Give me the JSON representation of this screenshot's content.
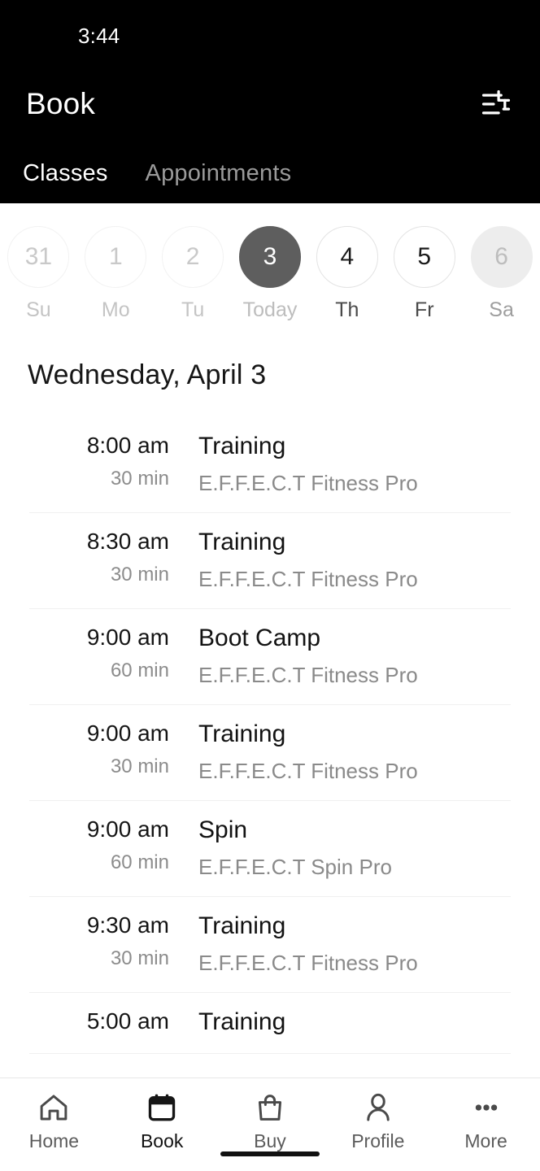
{
  "status_bar": {
    "time": "3:44"
  },
  "header": {
    "title": "Book",
    "filter_icon": "tune-sliders-icon",
    "tabs": [
      {
        "label": "Classes",
        "active": true
      },
      {
        "label": "Appointments",
        "active": false
      }
    ]
  },
  "date_strip": {
    "days": [
      {
        "number": "31",
        "weekday": "Su",
        "state": "past"
      },
      {
        "number": "1",
        "weekday": "Mo",
        "state": "past"
      },
      {
        "number": "2",
        "weekday": "Tu",
        "state": "past"
      },
      {
        "number": "3",
        "weekday": "Today",
        "state": "selected"
      },
      {
        "number": "4",
        "weekday": "Th",
        "state": "future"
      },
      {
        "number": "5",
        "weekday": "Fr",
        "state": "future"
      },
      {
        "number": "6",
        "weekday": "Sa",
        "state": "muted"
      }
    ]
  },
  "schedule": {
    "day_heading": "Wednesday, April 3",
    "rows": [
      {
        "time": "8:00 am",
        "duration": "30 min",
        "name": "Training",
        "location": "E.F.F.E.C.T Fitness Pro"
      },
      {
        "time": "8:30 am",
        "duration": "30 min",
        "name": "Training",
        "location": "E.F.F.E.C.T Fitness Pro"
      },
      {
        "time": "9:00 am",
        "duration": "60 min",
        "name": "Boot Camp",
        "location": "E.F.F.E.C.T Fitness Pro"
      },
      {
        "time": "9:00 am",
        "duration": "30 min",
        "name": "Training",
        "location": "E.F.F.E.C.T Fitness Pro"
      },
      {
        "time": "9:00 am",
        "duration": "60 min",
        "name": "Spin",
        "location": "E.F.F.E.C.T Spin Pro"
      },
      {
        "time": "9:30 am",
        "duration": "30 min",
        "name": "Training",
        "location": "E.F.F.E.C.T Fitness Pro"
      },
      {
        "time": "5:00 am",
        "duration": "",
        "name": "Training",
        "location": ""
      }
    ]
  },
  "bottom_nav": {
    "items": [
      {
        "label": "Home",
        "icon": "home-icon",
        "active": false
      },
      {
        "label": "Book",
        "icon": "calendar-icon",
        "active": true
      },
      {
        "label": "Buy",
        "icon": "bag-icon",
        "active": false
      },
      {
        "label": "Profile",
        "icon": "person-icon",
        "active": false
      },
      {
        "label": "More",
        "icon": "ellipsis-icon",
        "active": false
      }
    ]
  },
  "colors": {
    "header_bg": "#000000",
    "selected_day": "#5e5e5e",
    "muted_day": "#ededed",
    "divider": "#f0f0f0",
    "secondary_text": "#8a8a8a"
  }
}
